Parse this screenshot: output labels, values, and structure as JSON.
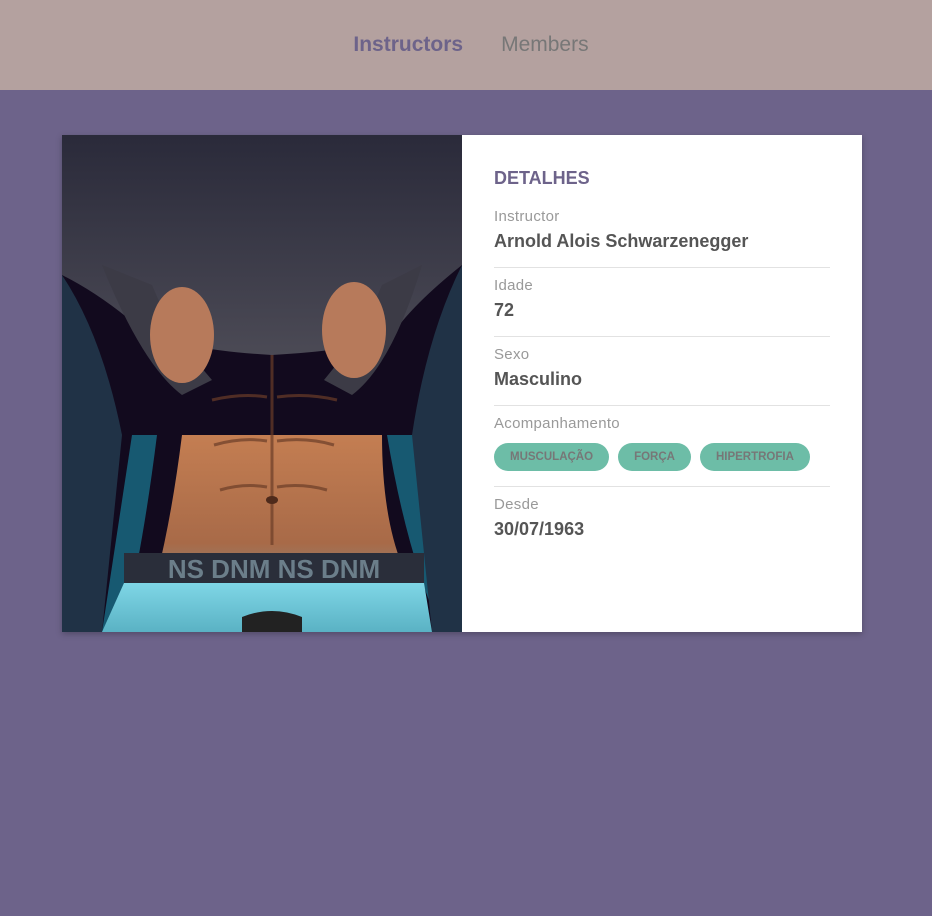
{
  "nav": {
    "instructors": "Instructors",
    "members": "Members"
  },
  "photo": {
    "alt": "Instructor photo"
  },
  "details": {
    "title": "Detalhes",
    "instructor_label": "Instructor",
    "instructor_value": "Arnold Alois Schwarzenegger",
    "age_label": "Idade",
    "age_value": "72",
    "sex_label": "Sexo",
    "sex_value": "Masculino",
    "services_label": "Acompanhamento",
    "services": [
      "musculação",
      "força",
      "hipertrofia"
    ],
    "since_label": "Desde",
    "since_value": "30/07/1963"
  }
}
